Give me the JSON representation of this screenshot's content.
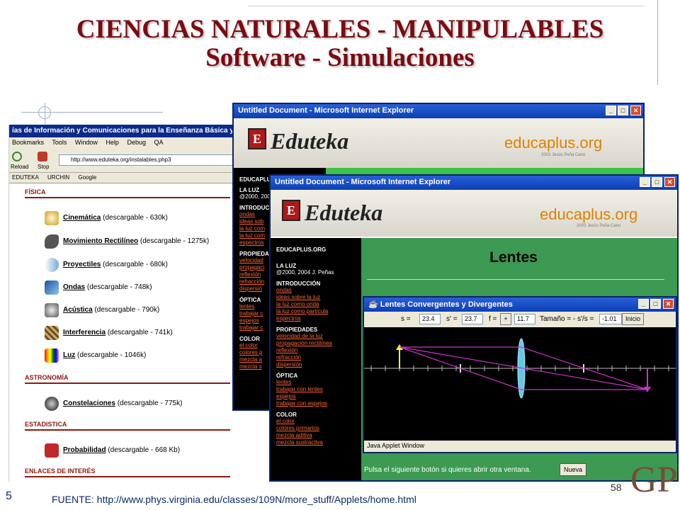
{
  "slide": {
    "title_line1": "CIENCIAS NATURALES - MANIPULABLES",
    "title_line2": "Software - Simulaciones",
    "source": "FUENTE: http://www.phys.virginia.edu/classes/109N/more_stuff/Applets/home.html",
    "page_number": "58",
    "slide_index": "5",
    "logo_letters": "GP"
  },
  "left_browser": {
    "title": "ías de Información y Comunicaciones para la Enseñanza Básica y Media",
    "menu": [
      "Bookmarks",
      "Tools",
      "Window",
      "Help",
      "Debug",
      "QA"
    ],
    "reload": "Reload",
    "stop": "Stop",
    "address": "http://www.eduteka.org/instalables.php3",
    "links": [
      "EDUTEKA",
      "URCHIN",
      "Google"
    ],
    "sections": {
      "fisica": "FÍSICA",
      "astronomia": "ASTRONOMÍA",
      "estadistica": "ESTADISTICA",
      "enlaces": "ENLACES DE INTERÉS"
    },
    "items": [
      {
        "name": "Cinemática",
        "size": "(descargable - 630k)"
      },
      {
        "name": "Movimiento Rectilíneo",
        "size": "(descargable - 1275k)"
      },
      {
        "name": "Proyectiles",
        "size": "(descargable - 680k)"
      },
      {
        "name": "Ondas",
        "size": "(descargable - 748k)"
      },
      {
        "name": "Acústica",
        "size": "(descargable - 790k)"
      },
      {
        "name": "Interferencia",
        "size": "(descargable - 741k)"
      },
      {
        "name": "Luz",
        "size": "(descargable - 1046k)"
      },
      {
        "name": "Constelaciones",
        "size": "(descargable - 775k)"
      },
      {
        "name": "Probabilidad",
        "size": "(descargable - 668 Kb)"
      }
    ]
  },
  "ie_back": {
    "title": "Untitled Document - Microsoft Internet Explorer",
    "logo": "Eduteka",
    "site": "educaplus.org",
    "site_sub": "2003 Jesús Peña Cano",
    "side": {
      "brand": "EDUCAPLUS",
      "topic": "LA LUZ",
      "year": "@2000, 200",
      "intro": "INTRODUC",
      "intro_links": [
        "ondas",
        "ideas sob",
        "la luz com",
        "la luz com",
        "espectros"
      ],
      "props": "PROPIEDA",
      "props_links": [
        "velocidad",
        "propagaci",
        "reflexión",
        "refracción",
        "dispersió"
      ],
      "optica": "ÓPTICA",
      "optica_links": [
        "lentes",
        "trabajar c",
        "espejos",
        "trabajar c"
      ],
      "color": "COLOR",
      "color_links": [
        "el color",
        "colores p",
        "mezcla a",
        "mezcla s"
      ]
    }
  },
  "ie_front": {
    "title": "Untitled Document - Microsoft Internet Explorer",
    "logo": "Eduteka",
    "site": "educaplus.org",
    "site_sub": "2003 Jesús Peña Cano",
    "heading": "Lentes",
    "side": {
      "brand": "EDUCAPLUS.ORG",
      "topic": "LA LUZ",
      "year": "@2000, 2004 J. Peñas",
      "intro": "INTRODUCCIÓN",
      "intro_links": [
        "ondas",
        "ideas sobre la luz",
        "la luz como onda",
        "la luz como partícula",
        "espectros"
      ],
      "props": "PROPIEDADES",
      "props_links": [
        "velocidad de la luz",
        "propagación rectilínea",
        "reflexión",
        "refracción",
        "dispersión"
      ],
      "optica": "ÓPTICA",
      "optica_links": [
        "lentes",
        "trabajar con lentes",
        "espejos",
        "trabajar con espejos"
      ],
      "color": "COLOR",
      "color_links": [
        "el color",
        "colores primarios",
        "mezcla aditiva",
        "mezcla sustractiva"
      ]
    },
    "bottom_text": "Pulsa el siguiente botón si quieres abrir otra ventana.",
    "new_button": "Nueva"
  },
  "applet": {
    "title": "Lentes Convergentes y Divergentes",
    "s_label": "s =",
    "s_value": "23.4",
    "sp_label": "s' =",
    "sp_value": "23.7",
    "f_label": "f =",
    "plus": "+",
    "f_value": "11.7",
    "size_label": "Tamaño = - s'/s =",
    "size_value": "-1.01",
    "start": "Inicio",
    "status": "Java Applet Window"
  },
  "colors": {
    "title": "#7a0c12",
    "titlebar": "#0b3fb3",
    "green": "#3c9a52",
    "side_link": "#ff6633"
  }
}
